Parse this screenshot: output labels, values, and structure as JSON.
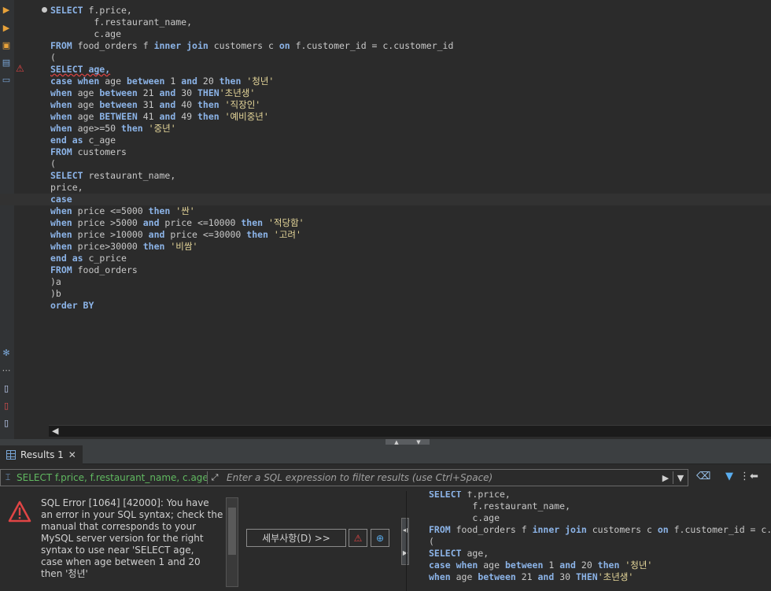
{
  "editor": {
    "lines": [
      [
        {
          "t": "SELECT",
          "c": "kw"
        },
        {
          "t": " f.price,"
        }
      ],
      [
        {
          "t": "        f.restaurant_name,"
        }
      ],
      [
        {
          "t": "        c.age"
        }
      ],
      [
        {
          "t": "FROM",
          "c": "kw"
        },
        {
          "t": " food_orders f "
        },
        {
          "t": "inner join",
          "c": "kw"
        },
        {
          "t": " customers c "
        },
        {
          "t": "on",
          "c": "kw"
        },
        {
          "t": " f.customer_id = c.customer_id"
        }
      ],
      [
        {
          "t": "("
        }
      ],
      [
        {
          "t": "SELECT age,",
          "c": "kw-err"
        }
      ],
      [
        {
          "t": "case when",
          "c": "kw"
        },
        {
          "t": " age "
        },
        {
          "t": "between",
          "c": "kw"
        },
        {
          "t": " 1 "
        },
        {
          "t": "and",
          "c": "kw"
        },
        {
          "t": " 20 "
        },
        {
          "t": "then",
          "c": "kw"
        },
        {
          "t": " "
        },
        {
          "t": "'청년'",
          "c": "str"
        }
      ],
      [
        {
          "t": "when",
          "c": "kw"
        },
        {
          "t": " age "
        },
        {
          "t": "between",
          "c": "kw"
        },
        {
          "t": " 21 "
        },
        {
          "t": "and",
          "c": "kw"
        },
        {
          "t": " 30 "
        },
        {
          "t": "THEN",
          "c": "kw"
        },
        {
          "t": "'초년생'",
          "c": "str"
        }
      ],
      [
        {
          "t": "when",
          "c": "kw"
        },
        {
          "t": " age "
        },
        {
          "t": "between",
          "c": "kw"
        },
        {
          "t": " 31 "
        },
        {
          "t": "and",
          "c": "kw"
        },
        {
          "t": " 40 "
        },
        {
          "t": "then",
          "c": "kw"
        },
        {
          "t": " "
        },
        {
          "t": "'직장인'",
          "c": "str"
        }
      ],
      [
        {
          "t": "when",
          "c": "kw"
        },
        {
          "t": " age "
        },
        {
          "t": "BETWEEN",
          "c": "kw"
        },
        {
          "t": " 41 "
        },
        {
          "t": "and",
          "c": "kw"
        },
        {
          "t": " 49 "
        },
        {
          "t": "then",
          "c": "kw"
        },
        {
          "t": " "
        },
        {
          "t": "'예비중년'",
          "c": "str"
        }
      ],
      [
        {
          "t": "when",
          "c": "kw"
        },
        {
          "t": " age>=50 "
        },
        {
          "t": "then",
          "c": "kw"
        },
        {
          "t": " "
        },
        {
          "t": "'중년'",
          "c": "str"
        }
      ],
      [
        {
          "t": "end as",
          "c": "kw"
        },
        {
          "t": " c_age"
        }
      ],
      [
        {
          "t": "FROM",
          "c": "kw"
        },
        {
          "t": " customers"
        }
      ],
      [
        {
          "t": "("
        }
      ],
      [
        {
          "t": "SELECT",
          "c": "kw"
        },
        {
          "t": " restaurant_name,"
        }
      ],
      [
        {
          "t": "price,"
        }
      ],
      [
        {
          "t": "case",
          "c": "kw"
        }
      ],
      [
        {
          "t": "when",
          "c": "kw"
        },
        {
          "t": " price <=5000 "
        },
        {
          "t": "then",
          "c": "kw"
        },
        {
          "t": " "
        },
        {
          "t": "'싼'",
          "c": "str"
        }
      ],
      [
        {
          "t": "when",
          "c": "kw"
        },
        {
          "t": " price >5000 "
        },
        {
          "t": "and",
          "c": "kw"
        },
        {
          "t": " price <=10000 "
        },
        {
          "t": "then",
          "c": "kw"
        },
        {
          "t": " "
        },
        {
          "t": "'적당함'",
          "c": "str"
        }
      ],
      [
        {
          "t": "when",
          "c": "kw"
        },
        {
          "t": " price >10000 "
        },
        {
          "t": "and",
          "c": "kw"
        },
        {
          "t": " price <=30000 "
        },
        {
          "t": "then",
          "c": "kw"
        },
        {
          "t": " "
        },
        {
          "t": "'고려'",
          "c": "str"
        }
      ],
      [
        {
          "t": "when",
          "c": "kw"
        },
        {
          "t": " price>30000 "
        },
        {
          "t": "then",
          "c": "kw"
        },
        {
          "t": " "
        },
        {
          "t": "'비쌈'",
          "c": "str"
        }
      ],
      [
        {
          "t": "end as",
          "c": "kw"
        },
        {
          "t": " c_price"
        }
      ],
      [
        {
          "t": "FROM",
          "c": "kw"
        },
        {
          "t": " food_orders"
        }
      ],
      [
        {
          "t": ")a"
        }
      ],
      [
        {
          "t": ")b"
        }
      ],
      [
        {
          "t": "order BY",
          "c": "kw"
        }
      ]
    ],
    "current_line": 16,
    "error_line": 5
  },
  "results": {
    "tab_label": "Results 1",
    "filter_query": "SELECT f.price, f.restaurant_name, c.age",
    "filter_placeholder": "Enter a SQL expression to filter results (use Ctrl+Space)",
    "error_message": "SQL Error [1064] [42000]: You have an error in your SQL syntax; check the manual that corresponds to your MySQL server version for the right syntax to use near 'SELECT age,\ncase when age between 1 and 20 then '청년'",
    "details_button": "세부사항(D) >>",
    "sql_lines": [
      [
        {
          "t": "SELECT",
          "c": "kw"
        },
        {
          "t": " f.price,"
        }
      ],
      [
        {
          "t": "        f.restaurant_name,"
        }
      ],
      [
        {
          "t": "        c.age"
        }
      ],
      [
        {
          "t": "FROM",
          "c": "kw"
        },
        {
          "t": " food_orders f "
        },
        {
          "t": "inner join",
          "c": "kw"
        },
        {
          "t": " customers c "
        },
        {
          "t": "on",
          "c": "kw"
        },
        {
          "t": " f.customer_id = c.customer_id"
        }
      ],
      [
        {
          "t": "("
        }
      ],
      [
        {
          "t": "SELECT",
          "c": "kw"
        },
        {
          "t": " age,"
        }
      ],
      [
        {
          "t": "case when",
          "c": "kw"
        },
        {
          "t": " age "
        },
        {
          "t": "between",
          "c": "kw"
        },
        {
          "t": " 1 "
        },
        {
          "t": "and",
          "c": "kw"
        },
        {
          "t": " 20 "
        },
        {
          "t": "then",
          "c": "kw"
        },
        {
          "t": " "
        },
        {
          "t": "'청년'",
          "c": "str"
        }
      ],
      [
        {
          "t": "when",
          "c": "kw"
        },
        {
          "t": " age "
        },
        {
          "t": "between",
          "c": "kw"
        },
        {
          "t": " 21 "
        },
        {
          "t": "and",
          "c": "kw"
        },
        {
          "t": " 30 "
        },
        {
          "t": "THEN",
          "c": "kw"
        },
        {
          "t": "'초년생'",
          "c": "str"
        }
      ]
    ]
  },
  "colors": {
    "keyword": "#8cb4e8",
    "string": "#e6d79a",
    "error": "#e04545",
    "query_preview": "#60b860"
  }
}
